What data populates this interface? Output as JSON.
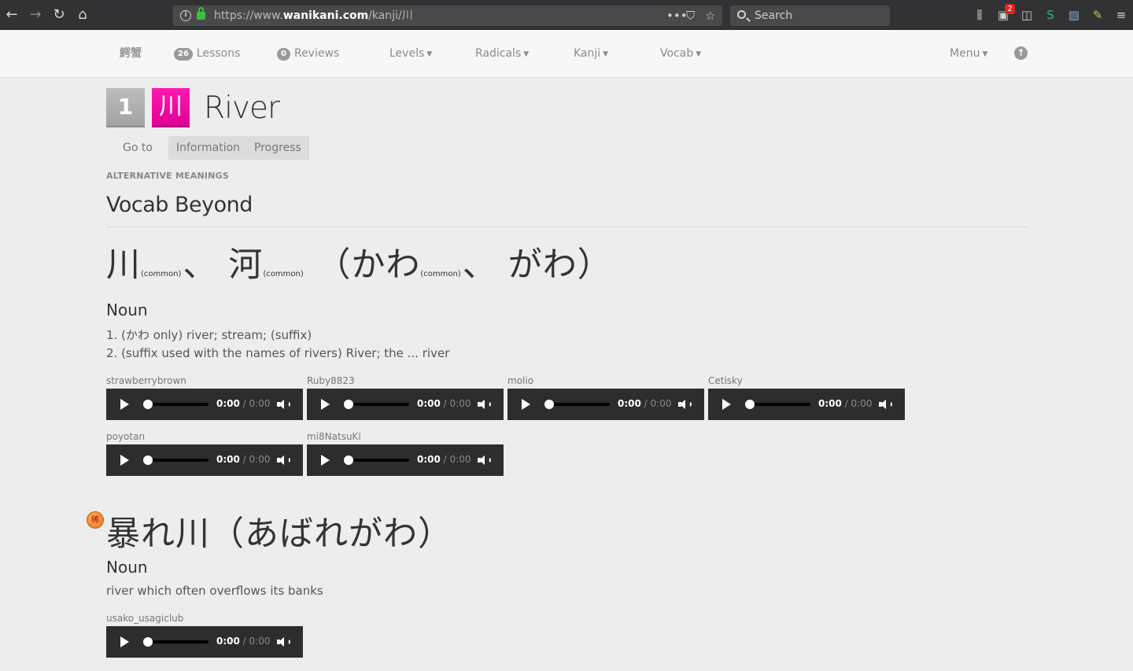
{
  "browser": {
    "url_prefix": "https://www.",
    "url_host": "wanikani.com",
    "url_path": "/kanji/川",
    "search_placeholder": "Search",
    "notification_count": "2",
    "icons": [
      "back-icon",
      "forward-icon",
      "reload-icon",
      "home-icon",
      "info-icon",
      "lock-icon",
      "more-icon",
      "pocket-icon",
      "bookmark-star-icon",
      "library-icon",
      "extension-icon",
      "sidebar-icon",
      "s-extension-icon",
      "screenshot-icon",
      "pen-icon",
      "hamburger-menu-icon"
    ]
  },
  "nav": {
    "logo": "鰐蟹",
    "lessons_count": "26",
    "lessons_label": "Lessons",
    "reviews_count": "0",
    "reviews_label": "Reviews",
    "levels_label": "Levels",
    "radicals_label": "Radicals",
    "kanji_label": "Kanji",
    "vocab_label": "Vocab",
    "menu_label": "Menu"
  },
  "header": {
    "level": "1",
    "kanji": "川",
    "meaning": "River"
  },
  "subtabs": {
    "goto": "Go to",
    "information": "Information",
    "progress": "Progress"
  },
  "section": {
    "label": "ALTERNATIVE MEANINGS",
    "title": "Vocab Beyond"
  },
  "entries": [
    {
      "word_parts": [
        "川",
        "(common)",
        "、",
        "河",
        "(common)",
        " （かわ",
        "(common)",
        "、",
        "がわ）"
      ],
      "pos": "Noun",
      "definitions": [
        "1. (かわ only) river; stream; (suffix)",
        "2. (suffix used with the names of rivers) River; the ... river"
      ],
      "audio": [
        {
          "user": "strawberrybrown",
          "current": "0:00",
          "duration": "0:00"
        },
        {
          "user": "Ruby8823",
          "current": "0:00",
          "duration": "0:00"
        },
        {
          "user": "molio",
          "current": "0:00",
          "duration": "0:00"
        },
        {
          "user": "Cetisky",
          "current": "0:00",
          "duration": "0:00"
        },
        {
          "user": "poyotan",
          "current": "0:00",
          "duration": "0:00"
        },
        {
          "user": "mi8NatsuKi",
          "current": "0:00",
          "duration": "0:00"
        }
      ]
    },
    {
      "rare_mark": "稀",
      "word": "暴れ川（あばれがわ）",
      "pos": "Noun",
      "definitions": [
        "river which often overflows its banks"
      ],
      "audio": [
        {
          "user": "usako_usagiclub",
          "current": "0:00",
          "duration": "0:00"
        }
      ]
    }
  ]
}
